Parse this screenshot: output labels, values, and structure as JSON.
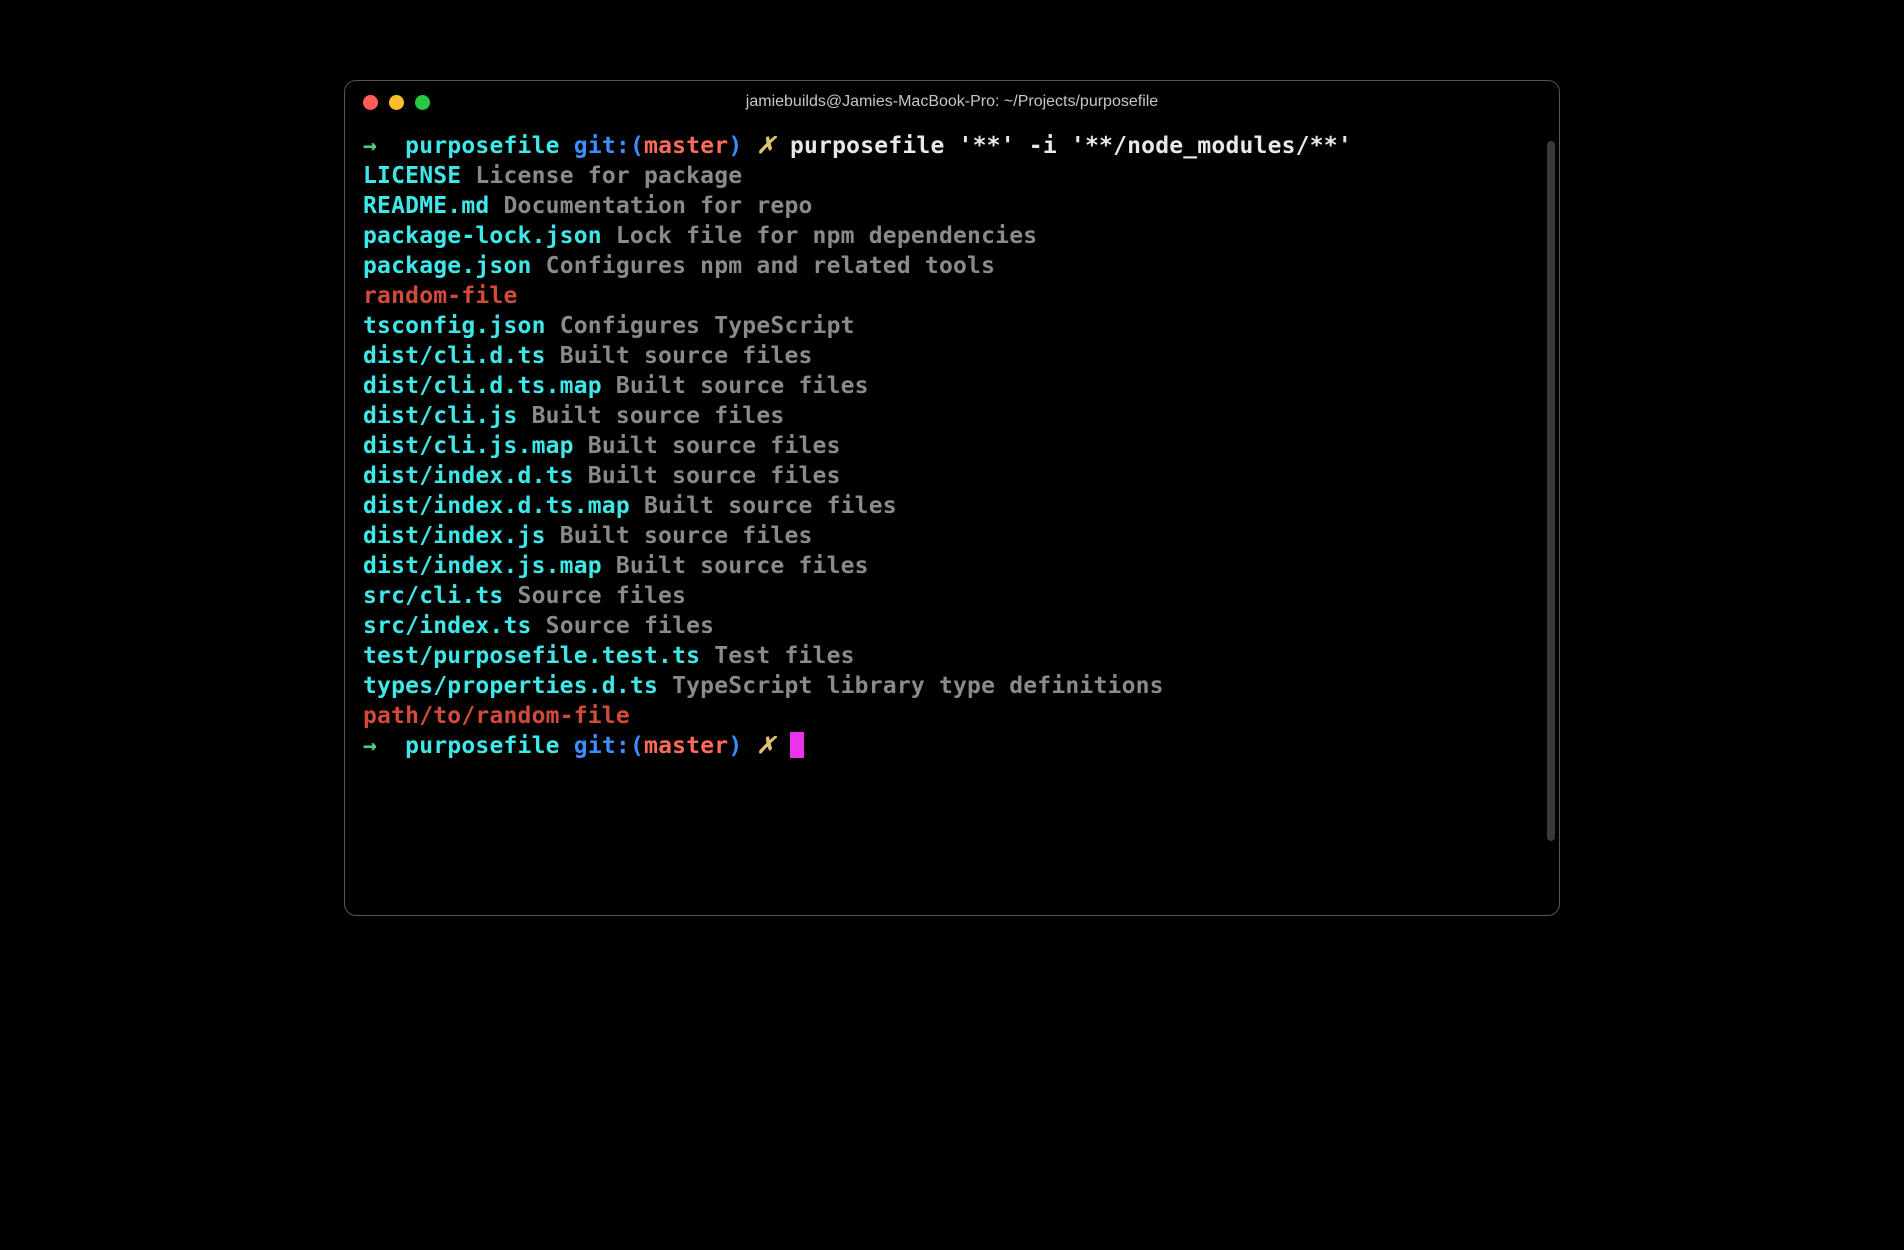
{
  "window": {
    "title": "jamiebuilds@Jamies-MacBook-Pro: ~/Projects/purposefile"
  },
  "prompt": {
    "arrow": "→",
    "cwd": "purposefile",
    "git_label": "git:(",
    "branch": "master",
    "git_close": ")",
    "dirty": "✗",
    "command": "purposefile '**' -i '**/node_modules/**'"
  },
  "output": [
    {
      "file": "LICENSE",
      "desc": "License for package",
      "color": "cyan"
    },
    {
      "file": "README.md",
      "desc": "Documentation for repo",
      "color": "cyan"
    },
    {
      "file": "package-lock.json",
      "desc": "Lock file for npm dependencies",
      "color": "cyan"
    },
    {
      "file": "package.json",
      "desc": "Configures npm and related tools",
      "color": "cyan"
    },
    {
      "file": "random-file",
      "desc": "",
      "color": "red"
    },
    {
      "file": "tsconfig.json",
      "desc": "Configures TypeScript",
      "color": "cyan"
    },
    {
      "file": "dist/cli.d.ts",
      "desc": "Built source files",
      "color": "cyan"
    },
    {
      "file": "dist/cli.d.ts.map",
      "desc": "Built source files",
      "color": "cyan"
    },
    {
      "file": "dist/cli.js",
      "desc": "Built source files",
      "color": "cyan"
    },
    {
      "file": "dist/cli.js.map",
      "desc": "Built source files",
      "color": "cyan"
    },
    {
      "file": "dist/index.d.ts",
      "desc": "Built source files",
      "color": "cyan"
    },
    {
      "file": "dist/index.d.ts.map",
      "desc": "Built source files",
      "color": "cyan"
    },
    {
      "file": "dist/index.js",
      "desc": "Built source files",
      "color": "cyan"
    },
    {
      "file": "dist/index.js.map",
      "desc": "Built source files",
      "color": "cyan"
    },
    {
      "file": "src/cli.ts",
      "desc": "Source files",
      "color": "cyan"
    },
    {
      "file": "src/index.ts",
      "desc": "Source files",
      "color": "cyan"
    },
    {
      "file": "test/purposefile.test.ts",
      "desc": "Test files",
      "color": "cyan"
    },
    {
      "file": "types/properties.d.ts",
      "desc": "TypeScript library type definitions",
      "color": "cyan"
    },
    {
      "file": "path/to/random-file",
      "desc": "",
      "color": "red"
    }
  ]
}
